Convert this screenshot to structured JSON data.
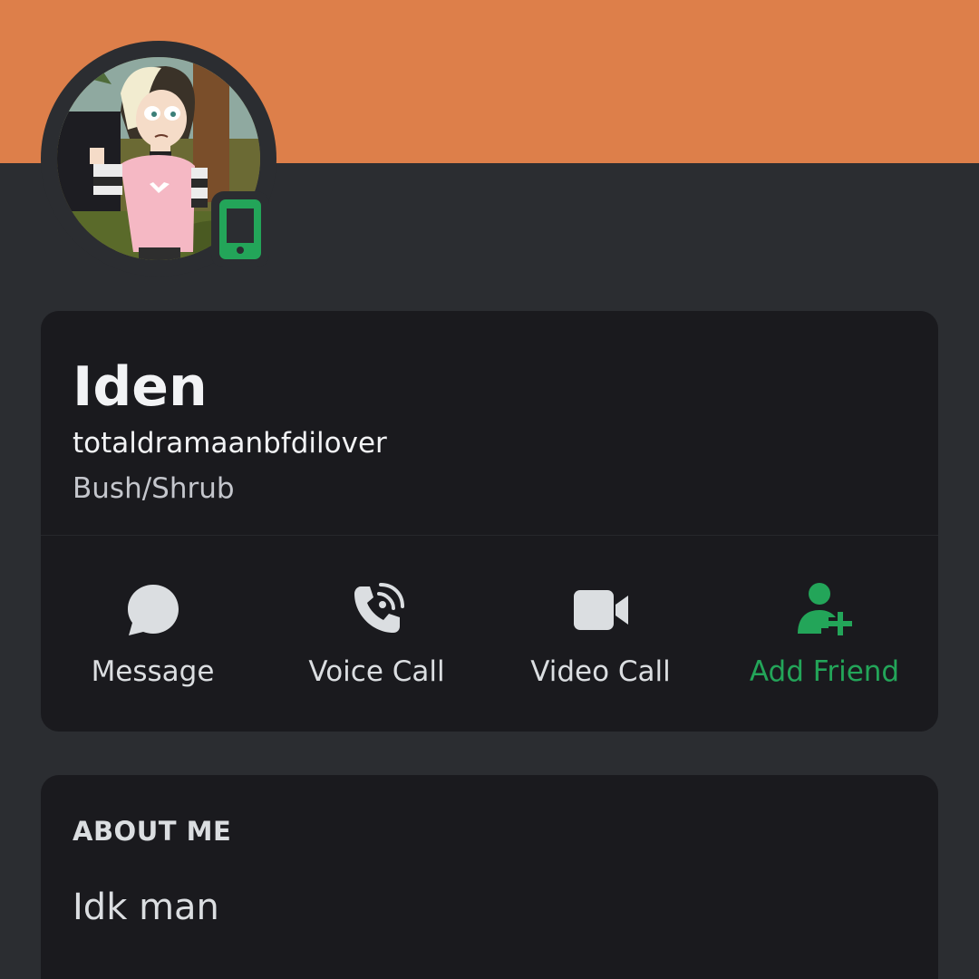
{
  "theme": {
    "banner_color": "#dd7f4a",
    "background_color": "#2b2d31",
    "card_color": "#1a1a1e",
    "accent_green": "#23a559"
  },
  "profile": {
    "display_name": "Iden",
    "username": "totaldramaanbfdilover",
    "pronouns": "Bush/Shrub",
    "status_icon": "mobile-online-icon",
    "avatar": "cartoon-character-avatar"
  },
  "actions": [
    {
      "label": "Message",
      "icon": "message-bubble-icon"
    },
    {
      "label": "Voice Call",
      "icon": "phone-call-icon"
    },
    {
      "label": "Video Call",
      "icon": "video-camera-icon"
    },
    {
      "label": "Add Friend",
      "icon": "add-friend-icon"
    }
  ],
  "about": {
    "heading": "ABOUT ME",
    "text": "Idk man"
  }
}
